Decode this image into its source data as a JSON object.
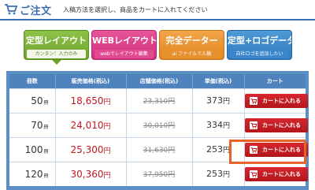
{
  "header": {
    "icon": "cart-icon",
    "title": "ご注文",
    "subtitle": "入稿方法を選択し、商品をカートに入れてください"
  },
  "tabs": [
    {
      "title": "定型レイアウト",
      "sub": "カンタン！入力のみ",
      "color": "#7cb33a",
      "active": true
    },
    {
      "title": "WEBレイアウト",
      "sub": "webでレイアウト編集",
      "color": "#e0408a"
    },
    {
      "title": "完全データー",
      "sub": "ai ファイルで入稿",
      "color": "#ec9a35"
    },
    {
      "title": "定型+ロゴデーター",
      "sub": "自社ロゴを追加したい",
      "color": "#3f8bcd"
    }
  ],
  "table": {
    "headers": [
      "冊数",
      "販売価格(税込)",
      "店舗価格(税込)",
      "単価(税込)",
      "カート"
    ],
    "qty_unit": "冊",
    "yen": "円",
    "cart_label": "カートに入れる",
    "rows": [
      {
        "qty": "50",
        "price": "18,650",
        "store": "23,310円",
        "unit": "373"
      },
      {
        "qty": "70",
        "price": "24,010",
        "store": "30,010円",
        "unit": "334"
      },
      {
        "qty": "100",
        "price": "25,300",
        "store": "31,630円",
        "unit": "253"
      },
      {
        "qty": "120",
        "price": "30,360",
        "store": "37,950円",
        "unit": "253"
      }
    ]
  },
  "colors": {
    "accent": "#3a6fb0",
    "price": "#c0181f",
    "cart": "#c41e26",
    "highlight": "#e8632a"
  }
}
